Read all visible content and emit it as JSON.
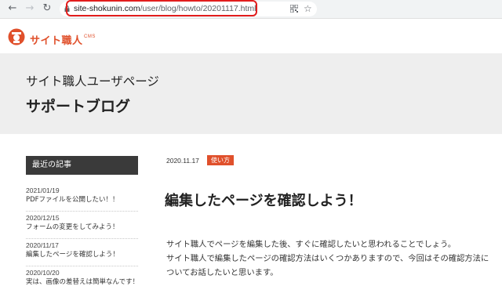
{
  "browser": {
    "url_domain": "site-shokunin.com",
    "url_path": "/user/blog/howto/20201117.html",
    "back_icon": "arrow-left",
    "forward_icon": "arrow-right",
    "reload_icon": "reload",
    "highlight_color": "#e21d1d"
  },
  "site": {
    "logo_text": "サイト職人",
    "logo_sub": "CMS",
    "brand_color": "#e0502b"
  },
  "hero": {
    "subtitle": "サイト職人ユーザページ",
    "title": "サポートブログ"
  },
  "sidebar": {
    "heading": "最近の記事",
    "posts": [
      {
        "date": "2021/01/19",
        "title": "PDFファイルを公開したい！！"
      },
      {
        "date": "2020/12/15",
        "title": "フォームの変更をしてみよう！"
      },
      {
        "date": "2020/11/17",
        "title": "編集したページを確認しよう！"
      },
      {
        "date": "2020/10/20",
        "title": "実は、画像の差替えは簡単なんです！"
      }
    ]
  },
  "article": {
    "date": "2020.11.17",
    "category": "使い方",
    "title": "編集したページを確認しよう！",
    "paragraph_1": "サイト職人でページを編集した後、すぐに確認したいと思われることでしょう。",
    "paragraph_2": "サイト職人で編集したページの確認方法はいくつかありますので、今回はその確認方法についてお話したいと思います。"
  }
}
